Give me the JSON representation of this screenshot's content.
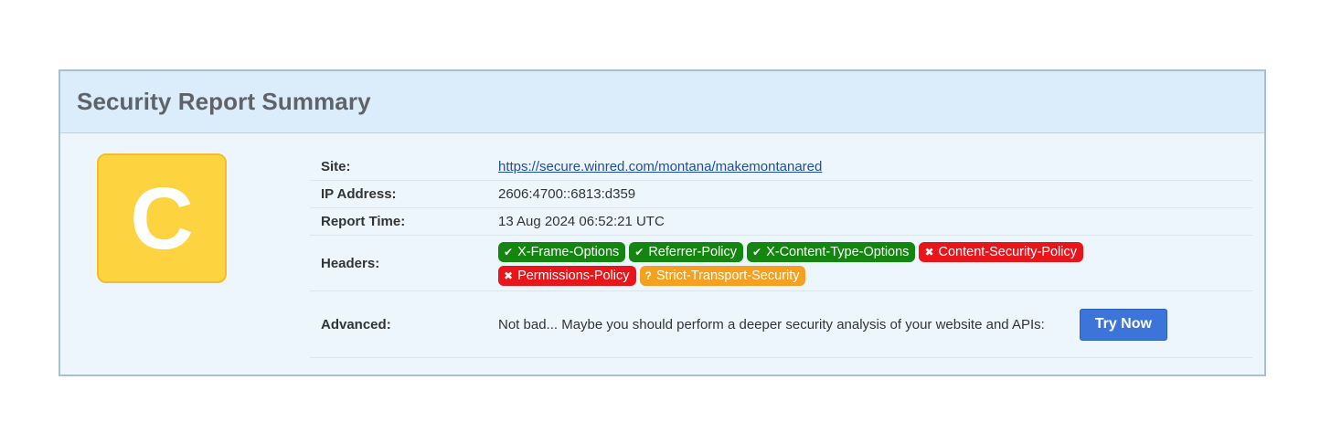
{
  "report": {
    "title": "Security Report Summary",
    "grade": "C",
    "rows": {
      "site_label": "Site:",
      "site_value": "https://secure.winred.com/montana/makemontanared",
      "ip_label": "IP Address:",
      "ip_value": "2606:4700::6813:d359",
      "time_label": "Report Time:",
      "time_value": "13 Aug 2024 06:52:21 UTC",
      "headers_label": "Headers:",
      "advanced_label": "Advanced:",
      "advanced_text": "Not bad... Maybe you should perform a deeper security analysis of your website and APIs:",
      "try_button": "Try Now"
    },
    "headers": [
      {
        "icon": "✔",
        "icon_name": "check-icon",
        "label": "X-Frame-Options",
        "status": "pass"
      },
      {
        "icon": "✔",
        "icon_name": "check-icon",
        "label": "Referrer-Policy",
        "status": "pass"
      },
      {
        "icon": "✔",
        "icon_name": "check-icon",
        "label": "X-Content-Type-Options",
        "status": "pass"
      },
      {
        "icon": "✖",
        "icon_name": "cross-icon",
        "label": "Content-Security-Policy",
        "status": "fail"
      },
      {
        "icon": "✖",
        "icon_name": "cross-icon",
        "label": "Permissions-Policy",
        "status": "fail"
      },
      {
        "icon": "?",
        "icon_name": "question-icon",
        "label": "Strict-Transport-Security",
        "status": "warn"
      }
    ]
  },
  "colors": {
    "grade_bg": "#fdd340",
    "pass": "#12860f",
    "fail": "#e8151a",
    "warn": "#f5a01e",
    "button": "#3d74d9"
  }
}
